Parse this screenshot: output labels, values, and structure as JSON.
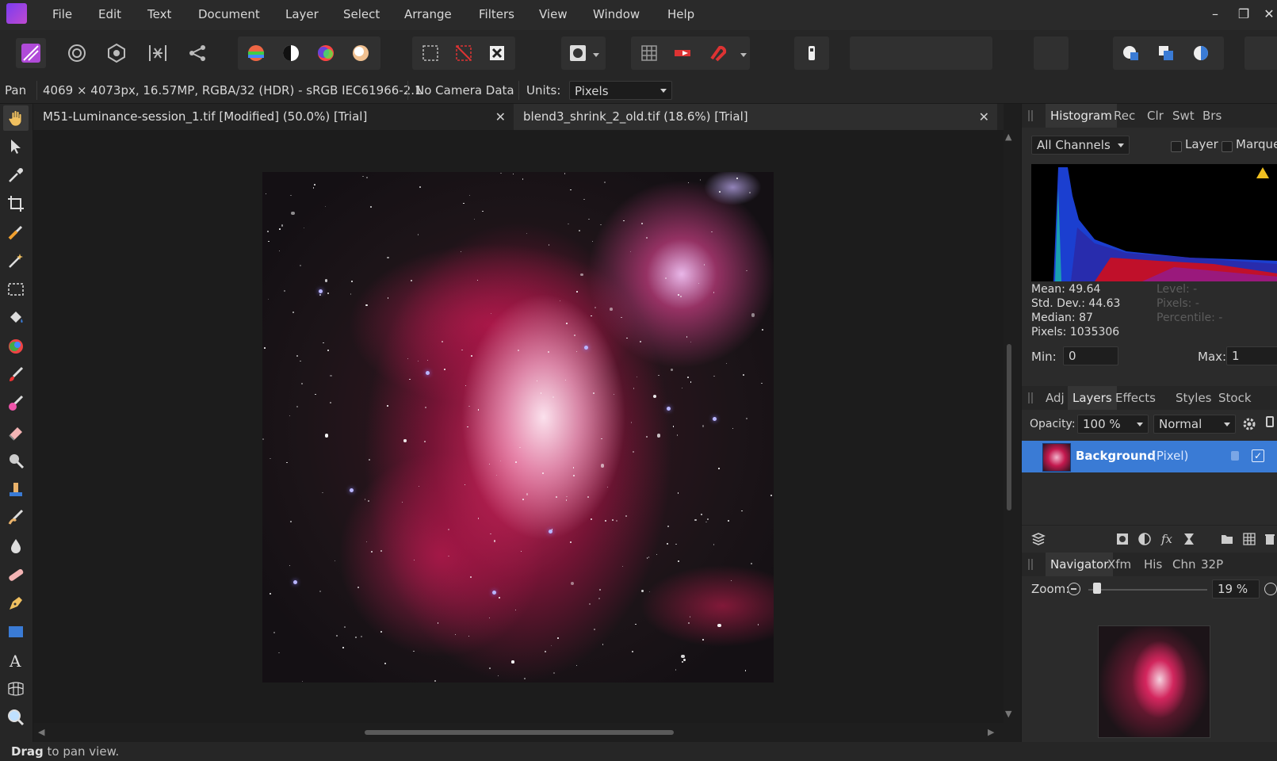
{
  "menu": [
    "File",
    "Edit",
    "Text",
    "Document",
    "Layer",
    "Select",
    "Arrange",
    "Filters",
    "View",
    "Window",
    "Help"
  ],
  "context": {
    "tool": "Pan",
    "doc_info": "4069 × 4073px, 16.57MP, RGBA/32 (HDR) - sRGB IEC61966-2.1",
    "camera": "No Camera Data",
    "units_label": "Units:",
    "units_value": "Pixels"
  },
  "tabs": [
    {
      "title": "M51-Luminance-session_1.tif [Modified] (50.0%) [Trial]"
    },
    {
      "title": "blend3_shrink_2_old.tif (18.6%) [Trial]"
    }
  ],
  "close_glyph": "✕",
  "status": {
    "bold": "Drag",
    "rest": " to pan view."
  },
  "histogram": {
    "tabs": [
      "Histogram",
      "Rec",
      "Clr",
      "Swt",
      "Brs"
    ],
    "channel": "All Channels",
    "layer_label": "Layer",
    "marquee_label": "Marque",
    "stats": [
      "Mean: 49.64",
      "Std. Dev.: 44.63",
      "Median: 87",
      "Pixels: 1035306"
    ],
    "stats_dim": [
      "Level: -",
      "Pixels: -",
      "Percentile: -"
    ],
    "min_label": "Min:",
    "min_value": "0",
    "max_label": "Max:",
    "max_value": "1"
  },
  "layers": {
    "tabs": [
      "Adj",
      "Layers",
      "Effects",
      "Styles",
      "Stock"
    ],
    "opacity_label": "Opacity:",
    "opacity_value": "100 %",
    "blend_mode": "Normal",
    "items": [
      {
        "name": "Background",
        "type": "(Pixel)"
      }
    ]
  },
  "navigator": {
    "tabs": [
      "Navigator",
      "Xfm",
      "His",
      "Chn",
      "32P"
    ],
    "zoom_label": "Zoom:",
    "zoom_value": "19 %"
  },
  "colors": {
    "accent": "#3a7bd5",
    "bg": "#1e1e1e",
    "panel": "#2b2b2b"
  }
}
